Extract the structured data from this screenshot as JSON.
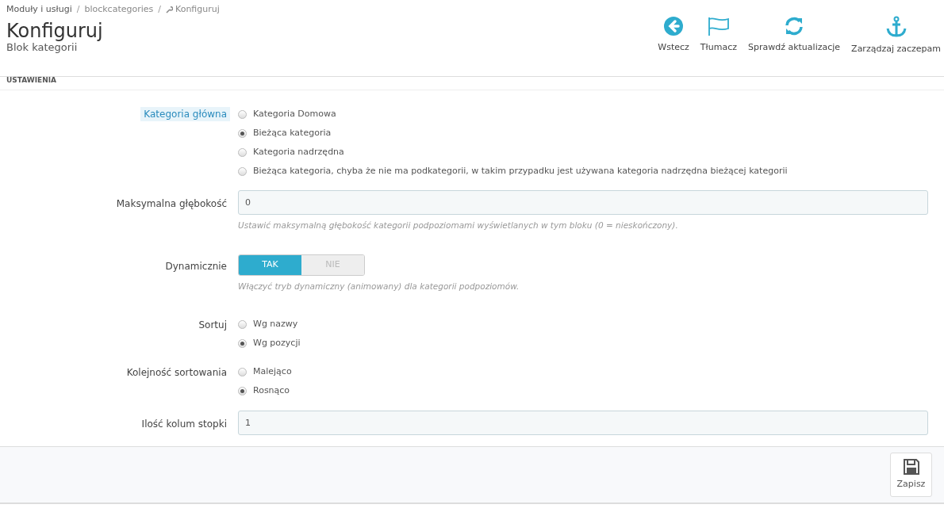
{
  "breadcrumb": [
    {
      "label": "Moduły i usługi"
    },
    {
      "separator": "/",
      "label": "blockcategories"
    },
    {
      "separator": "/",
      "label": "Konfiguruj",
      "icon": true
    }
  ],
  "page_title": "Konfiguruj",
  "page_subtitle": "Blok kategorii",
  "toolbar": [
    {
      "label": "Wstecz",
      "kind": "back"
    },
    {
      "label": "Tłumacz",
      "kind": "flag"
    },
    {
      "label": "Sprawdź aktualizacje",
      "kind": "refresh"
    },
    {
      "label": "Zarządzaj zaczepam",
      "kind": "anchor"
    }
  ],
  "panel_heading": "USTAWIENIA",
  "fields": [
    {
      "kind": "radio",
      "label": "Kategoria główna",
      "highlighted": true,
      "options": [
        {
          "label": "Kategoria Domowa",
          "selected": false
        },
        {
          "label": "Bieżąca kategoria",
          "selected": true
        },
        {
          "label": "Kategoria nadrzędna",
          "selected": false
        },
        {
          "label": "Bieżąca kategoria, chyba że nie ma podkategorii, w takim przypadku jest używana kategoria nadrzędna bieżącej kategorii",
          "selected": false
        }
      ]
    },
    {
      "kind": "text",
      "label": "Maksymalna głębokość",
      "value": "0",
      "help": "Ustawić maksymalną głębokość kategorii podpoziomami wyświetlanych w tym bloku (0 = nieskończony)."
    },
    {
      "kind": "switch",
      "label": "Dynamicznie",
      "options": [
        {
          "label": "TAK",
          "selected": true
        },
        {
          "label": "NIE",
          "selected": false
        }
      ],
      "help": "Włączyć tryb dynamiczny (animowany) dla kategorii podpoziomów."
    },
    {
      "kind": "radio",
      "label": "Sortuj",
      "options": [
        {
          "label": "Wg nazwy",
          "selected": false
        },
        {
          "label": "Wg pozycji",
          "selected": true
        }
      ]
    },
    {
      "kind": "radio",
      "label": "Kolejność sortowania",
      "options": [
        {
          "label": "Malejąco",
          "selected": false
        },
        {
          "label": "Rosnąco",
          "selected": true
        }
      ]
    },
    {
      "kind": "text",
      "label": "Ilość kolum stopki",
      "value": "1"
    }
  ],
  "save_button": "Zapisz"
}
